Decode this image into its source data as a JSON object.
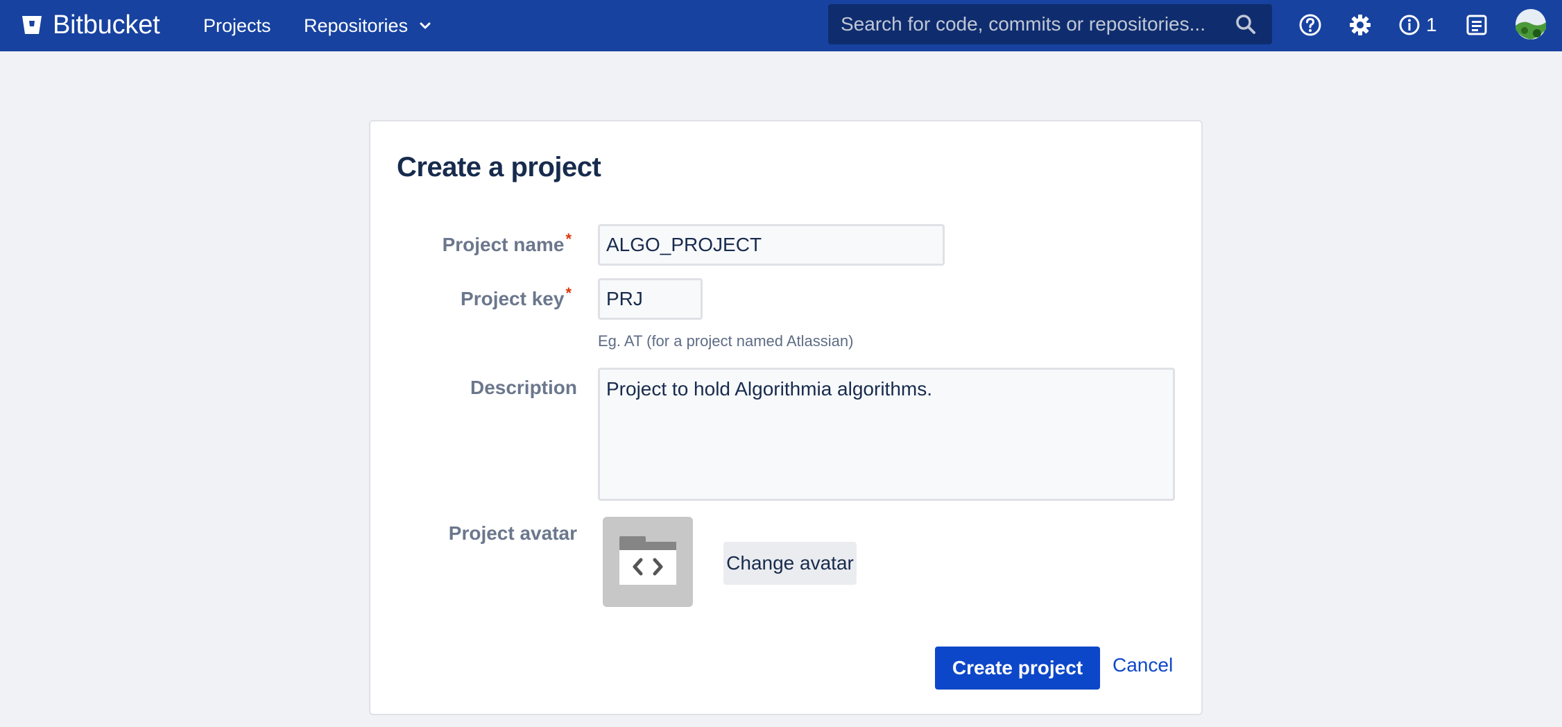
{
  "nav": {
    "brand": "Bitbucket",
    "projects_label": "Projects",
    "repositories_label": "Repositories",
    "search_placeholder": "Search for code, commits or repositories...",
    "notification_count": "1"
  },
  "form": {
    "title": "Create a project",
    "name_label": "Project name",
    "name_value": "ALGO_PROJECT",
    "key_label": "Project key",
    "key_value": "PRJ",
    "key_hint": "Eg. AT (for a project named Atlassian)",
    "description_label": "Description",
    "description_value": "Project to hold Algorithmia algorithms.",
    "avatar_label": "Project avatar",
    "required_marker": "*",
    "change_avatar_label": "Change avatar",
    "create_label": "Create project",
    "cancel_label": "Cancel"
  },
  "colors": {
    "nav_bg": "#1742a0",
    "primary": "#0d47c9",
    "required": "#de350b"
  }
}
